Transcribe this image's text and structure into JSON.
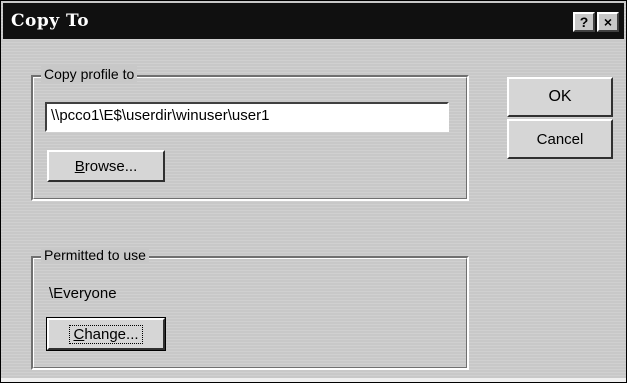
{
  "window": {
    "title": "Copy To",
    "help_glyph": "?",
    "close_glyph": "×"
  },
  "copy_group": {
    "legend": "Copy profile to",
    "path_value": "\\\\pcco1\\E$\\userdir\\winuser\\user1",
    "browse_mnemonic": "B",
    "browse_rest": "rowse..."
  },
  "permitted_group": {
    "legend": "Permitted to use",
    "user": "\\Everyone",
    "change_mnemonic": "C",
    "change_rest": "hange..."
  },
  "buttons": {
    "ok": "OK",
    "cancel": "Cancel"
  }
}
